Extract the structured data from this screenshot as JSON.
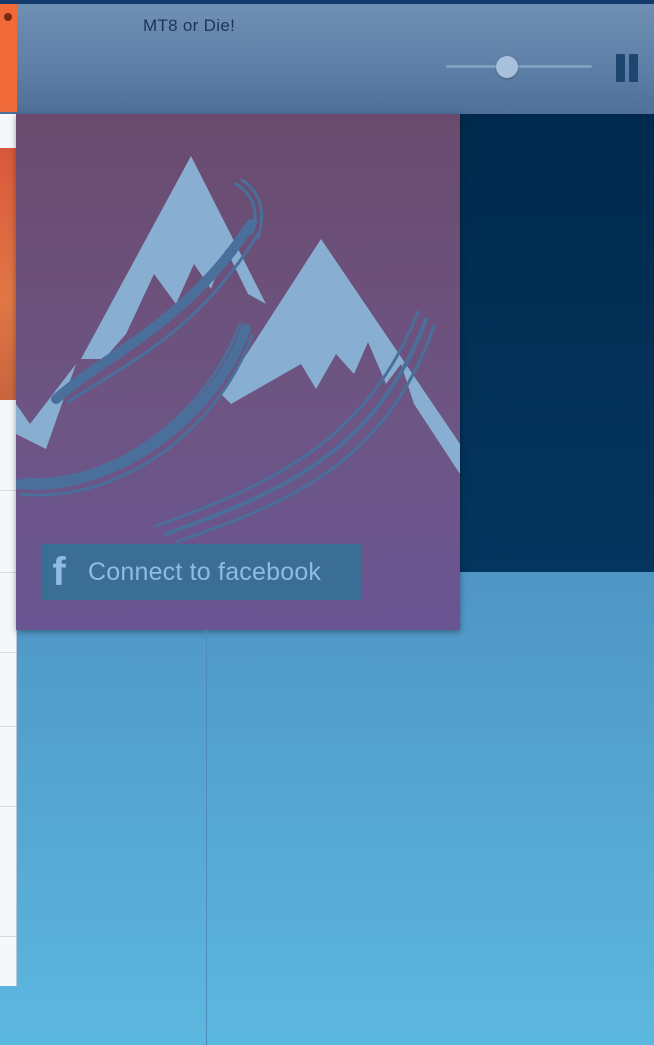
{
  "player": {
    "song_title": "MT8 or Die!",
    "volume_level": 0.42
  },
  "card": {
    "connect_label": "Connect to facebook",
    "facebook_glyph": "f"
  },
  "icons": {
    "pause": "pause-icon",
    "facebook": "facebook-icon",
    "mountains": "mountain-logo"
  },
  "colors": {
    "topbar": "#6688ad",
    "navy": "#02304f",
    "card": "#6a5080",
    "fb_button": "#3b6e95",
    "accent_orange": "#f06a3a"
  }
}
